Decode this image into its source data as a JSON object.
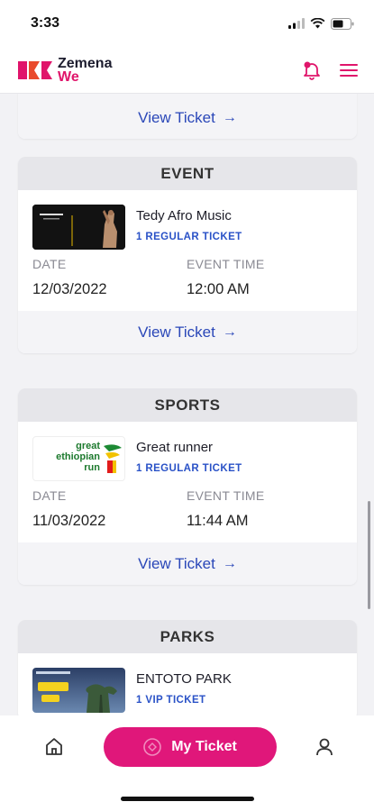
{
  "status": {
    "time": "3:33"
  },
  "brand": {
    "line1": "Zemena",
    "line2": "We",
    "accent": "#e0156b"
  },
  "partial_card": {
    "action_label": "View Ticket"
  },
  "cards": [
    {
      "category": "EVENT",
      "title": "Tedy Afro Music",
      "ticket": "1 REGULAR TICKET",
      "date_label": "DATE",
      "date": "12/03/2022",
      "time_label": "EVENT TIME",
      "time": "12:00 AM",
      "action_label": "View Ticket"
    },
    {
      "category": "SPORTS",
      "title": "Great runner",
      "ticket": "1 REGULAR TICKET",
      "date_label": "DATE",
      "date": "11/03/2022",
      "time_label": "EVENT TIME",
      "time": "11:44 AM",
      "action_label": "View Ticket",
      "logo_text": [
        "great",
        "ethiopian",
        "run"
      ]
    },
    {
      "category": "PARKS",
      "title": "ENTOTO PARK",
      "ticket": "1 VIP TICKET"
    }
  ],
  "nav": {
    "my_ticket_label": "My Ticket",
    "active_color": "#e0177a"
  },
  "icons": [
    "signal-icon",
    "wifi-icon",
    "battery-icon",
    "bell-icon",
    "menu-icon",
    "home-icon",
    "ticket-icon",
    "profile-icon",
    "arrow-right-icon"
  ]
}
